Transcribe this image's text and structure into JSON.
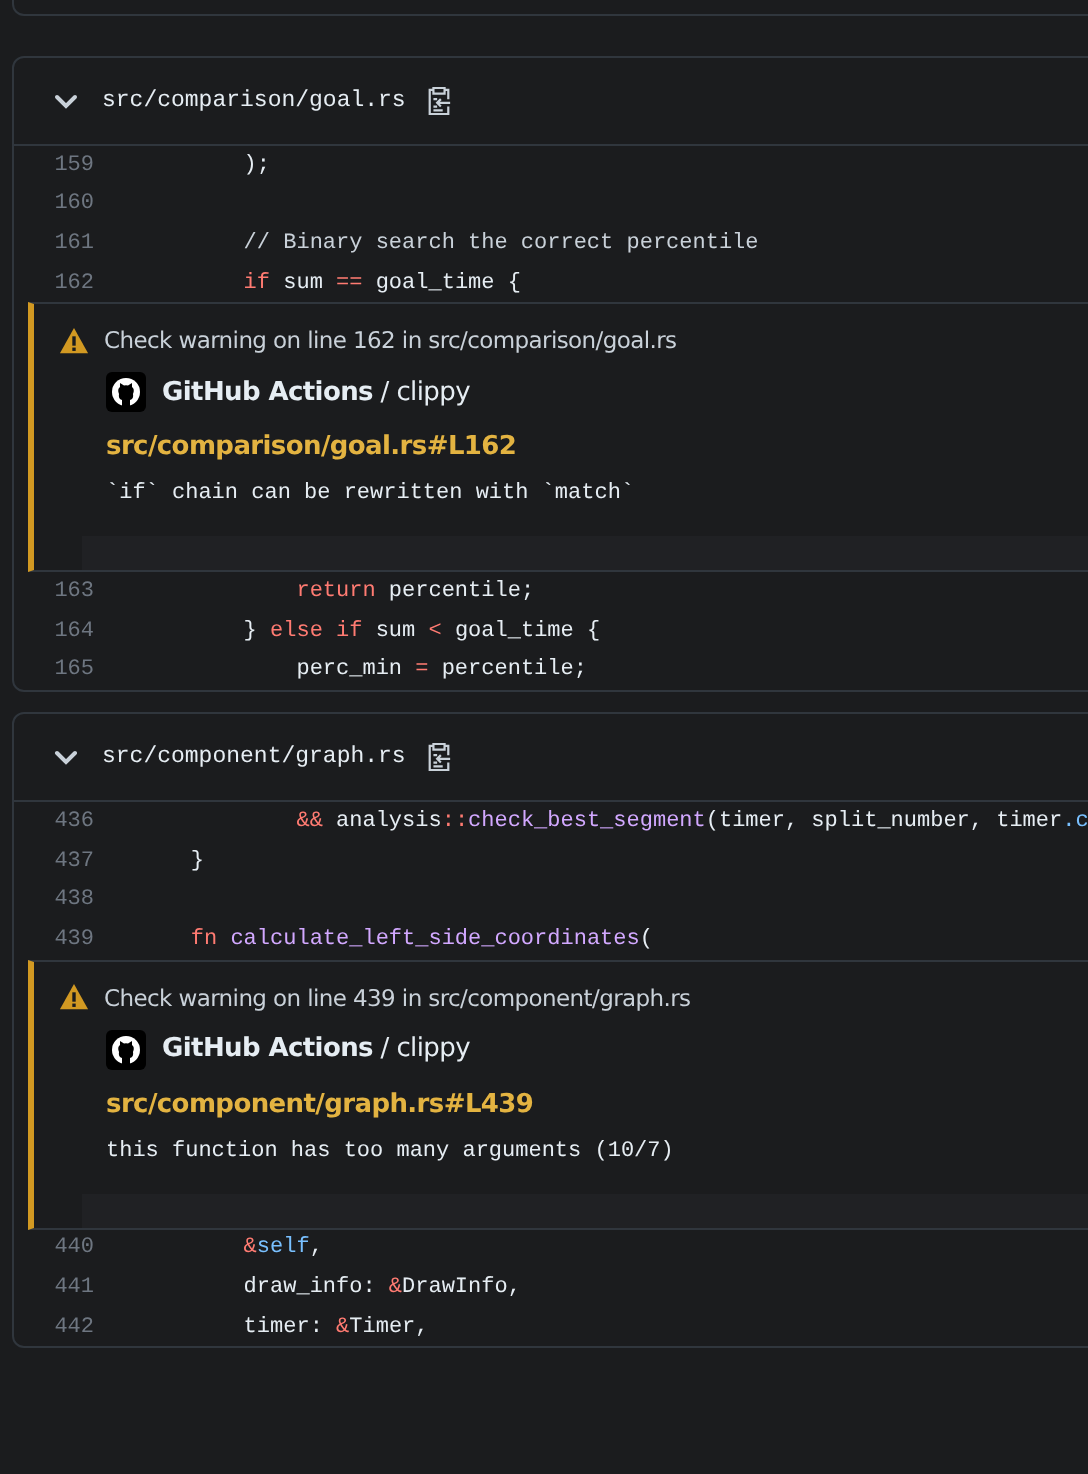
{
  "files": [
    {
      "path": "src/comparison/goal.rs",
      "expanded": true,
      "lines_before": [
        {
          "number": "159",
          "tokens": [
            {
              "kind": "plain",
              "text": "        );"
            }
          ]
        },
        {
          "number": "160"
        },
        {
          "number": "161",
          "tokens": [
            {
              "kind": "comment",
              "text": "        // Binary search the correct percentile"
            }
          ]
        },
        {
          "number": "162",
          "tokens": [
            {
              "kind": "keyword",
              "text": "        if"
            },
            {
              "kind": "plain",
              "text": " sum "
            },
            {
              "kind": "keyword",
              "text": "=="
            },
            {
              "kind": "plain",
              "text": " goal_time {"
            }
          ]
        }
      ],
      "annotation": {
        "kind": "warning",
        "heading": "Check warning on line 162 in src/comparison/goal.rs",
        "source": "**GitHub Actions** / clippy",
        "link": "src/comparison/goal.rs#L162",
        "message": "`if` chain can be rewritten with `match`"
      },
      "lines_after": [
        {
          "number": "163",
          "tokens": [
            {
              "kind": "keyword",
              "text": "            return"
            },
            {
              "kind": "plain",
              "text": " percentile;"
            }
          ]
        },
        {
          "number": "164",
          "tokens": [
            {
              "kind": "plain",
              "text": "        } "
            },
            {
              "kind": "keyword",
              "text": "else if"
            },
            {
              "kind": "plain",
              "text": " sum "
            },
            {
              "kind": "keyword",
              "text": "<"
            },
            {
              "kind": "plain",
              "text": " goal_time {"
            }
          ]
        },
        {
          "number": "165",
          "tokens": [
            {
              "kind": "plain",
              "text": "            perc_min "
            },
            {
              "kind": "keyword",
              "text": "="
            },
            {
              "kind": "plain",
              "text": " percentile;"
            }
          ]
        }
      ]
    },
    {
      "path": "src/component/graph.rs",
      "expanded": true,
      "lines_before": [
        {
          "number": "436",
          "tokens": [
            {
              "kind": "keyword",
              "text": "            &&"
            },
            {
              "kind": "plain",
              "text": " analysis"
            },
            {
              "kind": "keyword",
              "text": "::"
            },
            {
              "kind": "function",
              "text": "check_best_segment"
            },
            {
              "kind": "plain",
              "text": "(timer, split_number, timer"
            },
            {
              "kind": "constant",
              "text": ".c"
            }
          ]
        },
        {
          "number": "437",
          "tokens": [
            {
              "kind": "plain",
              "text": "    }"
            }
          ]
        },
        {
          "number": "438"
        },
        {
          "number": "439",
          "tokens": [
            {
              "kind": "keyword",
              "text": "    fn"
            },
            {
              "kind": "function",
              "text": " calculate_left_side_coordinates"
            },
            {
              "kind": "plain",
              "text": "("
            }
          ]
        }
      ],
      "annotation": {
        "kind": "warning",
        "heading": "Check warning on line 439 in src/component/graph.rs",
        "source": "**GitHub Actions** / clippy",
        "link": "src/component/graph.rs#L439",
        "message": "this function has too many arguments (10/7)"
      },
      "lines_after": [
        {
          "number": "440",
          "tokens": [
            {
              "kind": "keyword",
              "text": "        &"
            },
            {
              "kind": "constant",
              "text": "self"
            },
            {
              "kind": "plain",
              "text": ","
            }
          ]
        },
        {
          "number": "441",
          "tokens": [
            {
              "kind": "plain",
              "text": "        draw_info: "
            },
            {
              "kind": "keyword",
              "text": "&"
            },
            {
              "kind": "plain",
              "text": "DrawInfo,"
            }
          ]
        },
        {
          "number": "442",
          "tokens": [
            {
              "kind": "plain",
              "text": "        timer: "
            },
            {
              "kind": "keyword",
              "text": "&"
            },
            {
              "kind": "plain",
              "text": "Timer,"
            }
          ]
        }
      ]
    }
  ]
}
